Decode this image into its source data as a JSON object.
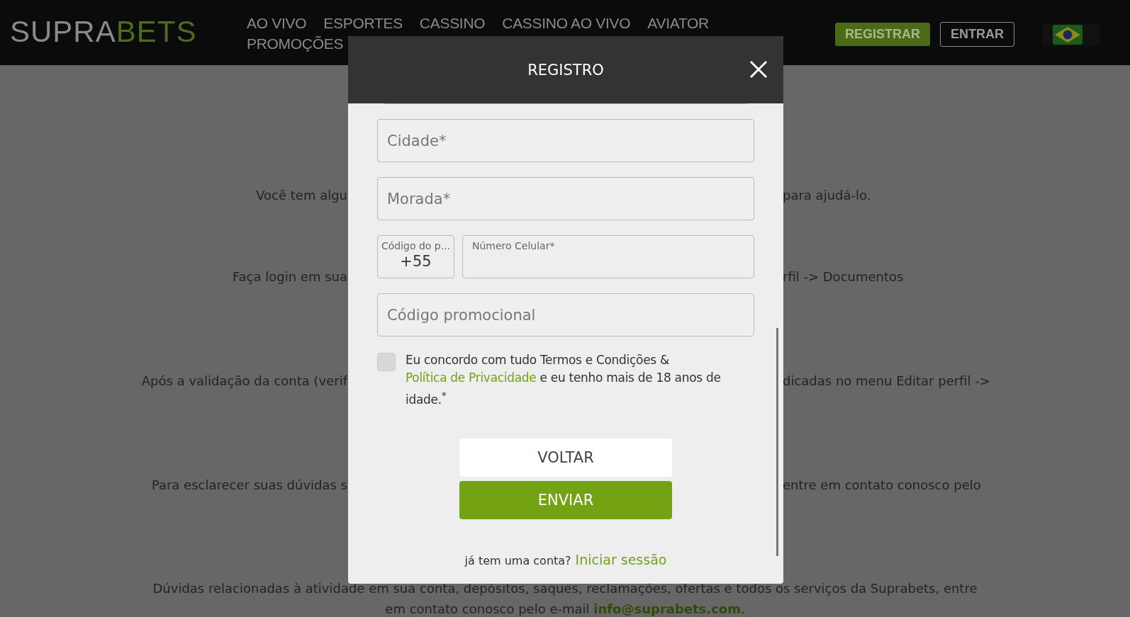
{
  "header": {
    "logo": {
      "first": "SUPRA",
      "second": "BETS"
    },
    "nav": [
      {
        "label": "AO VIVO"
      },
      {
        "label": "ESPORTES"
      },
      {
        "label": "CASSINO"
      },
      {
        "label": "CASSINO AO VIVO"
      },
      {
        "label": "AVIATOR"
      },
      {
        "label": "PROMOÇÕES"
      }
    ],
    "register_button": "REGISTRAR",
    "login_button": "ENTRAR"
  },
  "background_lines": [
    {
      "left": "Você tem algu",
      "right": "para ajudá-lo."
    },
    {
      "left": "Faça login em sua",
      "right": "rfil -> Documentos"
    },
    {
      "left": "Após a validação da conta (verif",
      "right": "dicadas no menu Editar perfil ->"
    },
    {
      "left": "Para esclarecer suas dúvidas s",
      "right": "entre em contato conosco pelo"
    }
  ],
  "footer_paragraph": {
    "line1": "Dúvidas relacionadas à atividade em sua conta, depósitos, saques, reclamações, ofertas e todos os serviços da Suprabets, entre",
    "line2_before": "em contato conosco pelo e-mail ",
    "email": "info@suprabets.com",
    "line2_after": "."
  },
  "modal": {
    "title": "REGISTRO",
    "fields": [
      {
        "placeholder": "Cidade*"
      },
      {
        "placeholder": "Morada*"
      }
    ],
    "phone": {
      "code_label": "Código do p...",
      "code_value": "+55",
      "number_label": "Número Celular*"
    },
    "promo": {
      "placeholder": "Código promocional"
    },
    "terms": {
      "checked": false,
      "before": "Eu concordo com tudo Termos e Condições & ",
      "link": "Política de Privacidade",
      "after": " e eu tenho mais de 18 anos de idade.",
      "mark": "*"
    },
    "back_button": "VOLTAR",
    "submit_button": "ENVIAR",
    "login_prompt": "já tem uma conta?",
    "login_link": "Iniciar sessão"
  }
}
